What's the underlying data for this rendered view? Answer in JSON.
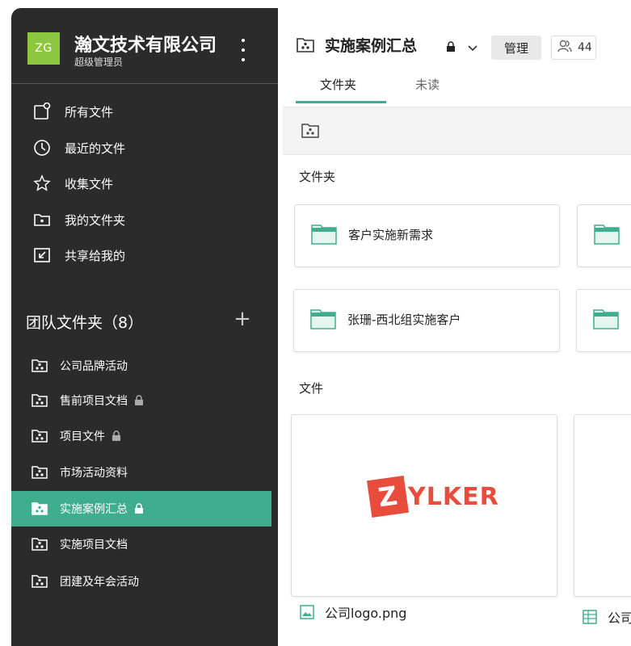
{
  "org": {
    "initials": "ZG",
    "name": "瀚文技术有限公司",
    "role": "超级管理员"
  },
  "nav": {
    "items": [
      {
        "label": "所有文件",
        "icon": "all-files-icon"
      },
      {
        "label": "最近的文件",
        "icon": "clock-icon"
      },
      {
        "label": "收集文件",
        "icon": "star-icon"
      },
      {
        "label": "我的文件夹",
        "icon": "my-folder-icon"
      },
      {
        "label": "共享给我的",
        "icon": "shared-icon"
      }
    ]
  },
  "team": {
    "heading": "团队文件夹（8）",
    "add": "+",
    "items": [
      {
        "label": "公司品牌活动",
        "locked": false
      },
      {
        "label": "售前项目文档",
        "locked": true
      },
      {
        "label": "项目文件",
        "locked": true
      },
      {
        "label": "市场活动资料",
        "locked": false
      },
      {
        "label": "实施案例汇总",
        "locked": true,
        "active": true
      },
      {
        "label": "实施项目文档",
        "locked": false
      },
      {
        "label": "团建及年会活动",
        "locked": false
      }
    ]
  },
  "header": {
    "title": "实施案例汇总",
    "manage": "管理",
    "members_count": "44"
  },
  "tabs": [
    {
      "label": "文件夹",
      "active": true
    },
    {
      "label": "未读",
      "active": false
    }
  ],
  "sections": {
    "folders": "文件夹",
    "files": "文件"
  },
  "folders": [
    {
      "label": "客户实施新需求"
    },
    {
      "label": "张珊-西北组实施客户"
    }
  ],
  "files": [
    {
      "name": "公司logo.png",
      "preview_text": "YLKER",
      "preview_letter": "Z"
    },
    {
      "name": "公司"
    }
  ],
  "colors": {
    "sidebar_bg": "#2b2b2b",
    "accent": "#3fae8e",
    "avatar": "#8cc63f",
    "brand_red": "#e74c3c"
  }
}
